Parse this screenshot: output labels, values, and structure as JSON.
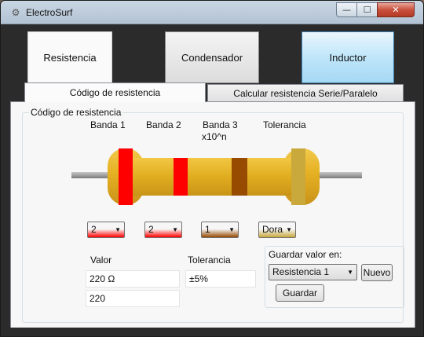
{
  "window": {
    "title": "ElectroSurf",
    "app_icon": "gear-icon",
    "minimize_glyph": "—",
    "maximize_glyph": "☐",
    "close_glyph": "✕"
  },
  "nav": {
    "resistencia": "Resistencia",
    "condensador": "Condensador",
    "inductor": "Inductor"
  },
  "tabs": [
    {
      "label": "Código de resistencia",
      "selected": true
    },
    {
      "label": "Calcular resistencia Serie/Paralelo",
      "selected": false
    }
  ],
  "group": {
    "title": "Código de resistencia",
    "band1_label": "Banda 1",
    "band2_label": "Banda 2",
    "band3_label": "Banda 3",
    "band3_sub": "x10^n",
    "tolerance_label": "Tolerancia"
  },
  "bands": {
    "band1": {
      "value": "2",
      "color": "#ff0000"
    },
    "band2": {
      "value": "2",
      "color": "#ff0000"
    },
    "band3": {
      "value": "1",
      "color": "#964b00"
    },
    "tolerance": {
      "value": "Dora",
      "color": "#c9a83c"
    }
  },
  "result": {
    "valor_label": "Valor",
    "valor_text": "220 Ω",
    "valor_number": "220",
    "tolerancia_label": "Tolerancia",
    "tolerancia_value": "±5%"
  },
  "save": {
    "label": "Guardar valor en:",
    "target": "Resistencia 1",
    "new_button": "Nuevo",
    "save_button": "Guardar"
  },
  "colors": {
    "window_bg": "#2b2b2b",
    "inductor_highlight": "#bfe6fa",
    "resistor_body": "#e5b022"
  }
}
